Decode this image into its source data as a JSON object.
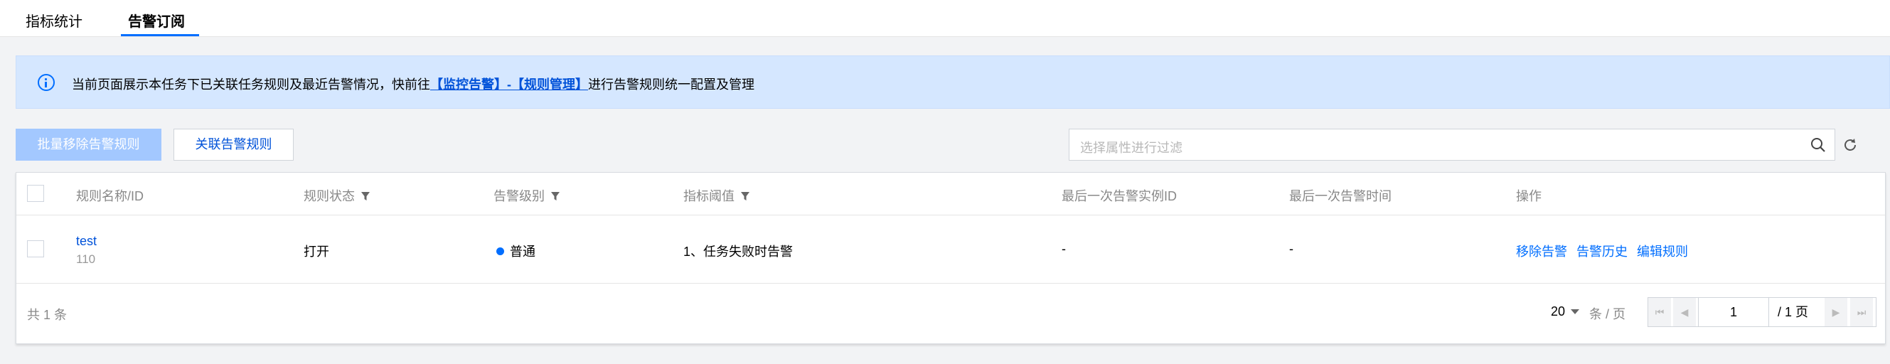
{
  "tabs": [
    {
      "label": "指标统计",
      "active": false
    },
    {
      "label": "告警订阅",
      "active": true
    }
  ],
  "notice": {
    "prefix": "当前页面展示本任务下已关联任务规则及最近告警情况，快前往",
    "link": "【监控告警】-【规则管理】",
    "suffix": "进行告警规则统一配置及管理"
  },
  "toolbar": {
    "batch_remove_label": "批量移除告警规则",
    "associate_label": "关联告警规则",
    "search_placeholder": "选择属性进行过滤"
  },
  "table": {
    "columns": [
      "规则名称/ID",
      "规则状态",
      "告警级别",
      "指标阈值",
      "最后一次告警实例ID",
      "最后一次告警时间",
      "操作"
    ],
    "rows": [
      {
        "name": "test",
        "id": "110",
        "status": "打开",
        "level": "普通",
        "threshold": "1、任务失败时告警",
        "last_instance_id": "-",
        "last_time": "-",
        "actions": [
          "移除告警",
          "告警历史",
          "编辑规则"
        ]
      }
    ]
  },
  "footer": {
    "total": "共 1 条",
    "page_size": "20",
    "per_page_label": "条 / 页",
    "current_page": "1",
    "total_pages": "/ 1 页"
  },
  "colors": {
    "accent": "#006eff",
    "link": "#0052d9",
    "notice_bg": "#d5e7ff",
    "primary_disabled": "#a3c8ff"
  }
}
